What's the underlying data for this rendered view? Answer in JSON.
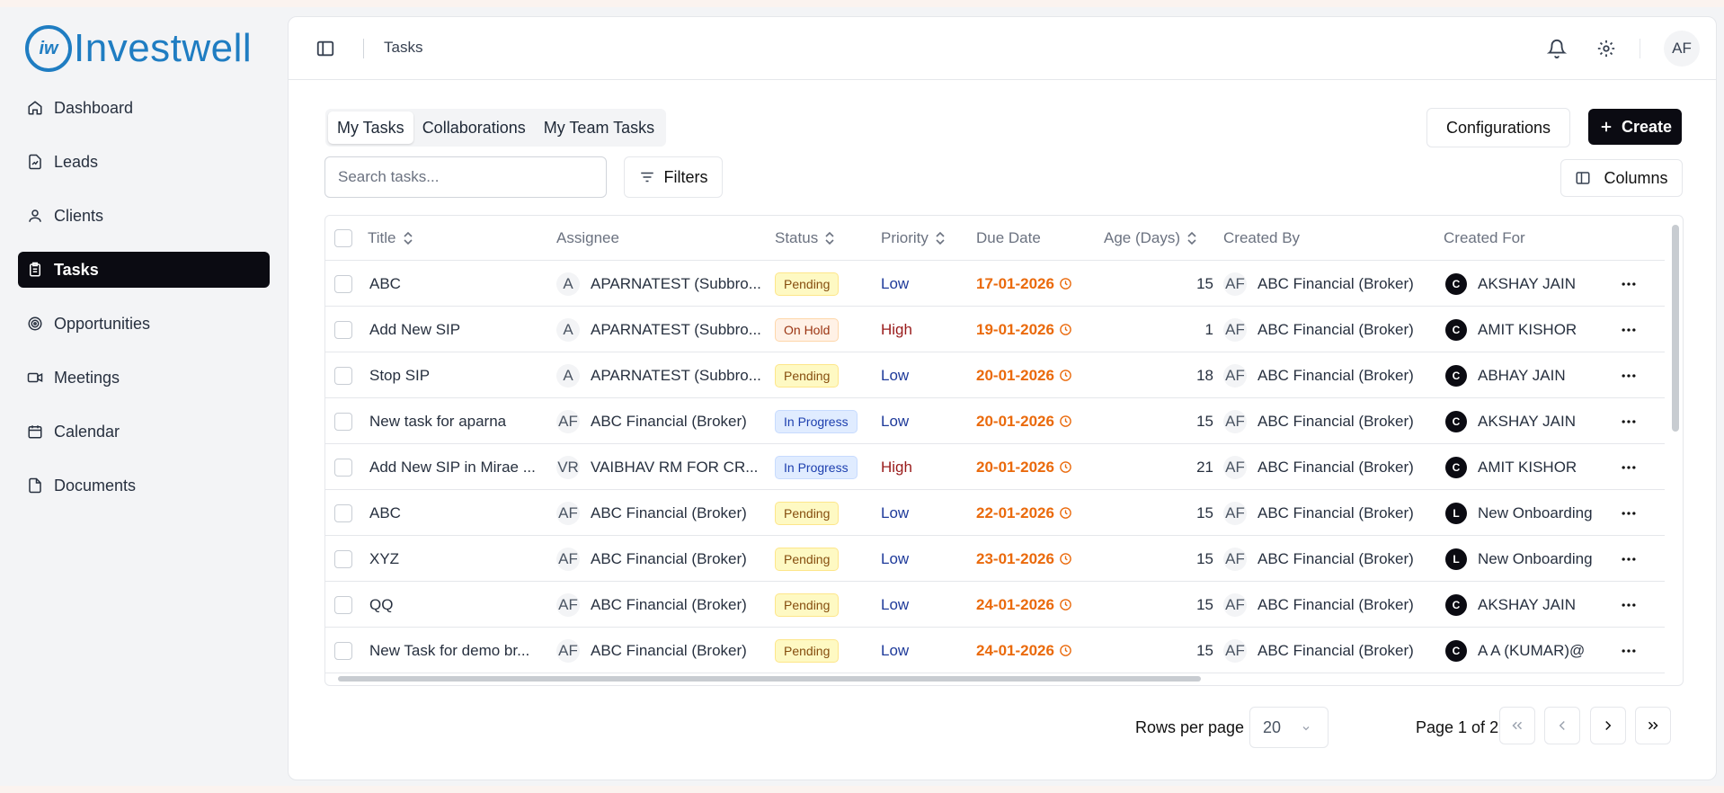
{
  "brand": {
    "logo_mark": "iw",
    "name": "Investwell",
    "color": "#1f7dc2"
  },
  "sidebar": {
    "items": [
      {
        "label": "Dashboard",
        "icon": "home-icon"
      },
      {
        "label": "Leads",
        "icon": "file-chart-icon"
      },
      {
        "label": "Clients",
        "icon": "user-icon"
      },
      {
        "label": "Tasks",
        "icon": "clipboard-list-icon",
        "active": true
      },
      {
        "label": "Opportunities",
        "icon": "target-icon"
      },
      {
        "label": "Meetings",
        "icon": "video-icon"
      },
      {
        "label": "Calendar",
        "icon": "calendar-icon"
      },
      {
        "label": "Documents",
        "icon": "document-icon"
      }
    ]
  },
  "header": {
    "title": "Tasks",
    "avatar": "AF"
  },
  "tabs": [
    {
      "label": "My Tasks",
      "active": true
    },
    {
      "label": "Collaborations"
    },
    {
      "label": "My Team Tasks"
    }
  ],
  "toolbar": {
    "configurations_label": "Configurations",
    "create_label": "Create",
    "search_placeholder": "Search tasks...",
    "filters_label": "Filters",
    "columns_label": "Columns"
  },
  "table": {
    "columns": [
      "Title",
      "Assignee",
      "Status",
      "Priority",
      "Due Date",
      "Age (Days)",
      "Created By",
      "Created For"
    ],
    "rows": [
      {
        "title": "ABC",
        "assignee_initial": "A",
        "assignee": "APARNATEST (Subbro...",
        "status": "Pending",
        "priority": "Low",
        "due": "17-01-2026",
        "age": "15",
        "created_by_initial": "AF",
        "created_by": "ABC Financial (Broker)",
        "for_initial": "C",
        "created_for": "AKSHAY JAIN"
      },
      {
        "title": "Add New SIP",
        "assignee_initial": "A",
        "assignee": "APARNATEST (Subbro...",
        "status": "On Hold",
        "priority": "High",
        "due": "19-01-2026",
        "age": "1",
        "created_by_initial": "AF",
        "created_by": "ABC Financial (Broker)",
        "for_initial": "C",
        "created_for": "AMIT KISHOR"
      },
      {
        "title": "Stop SIP",
        "assignee_initial": "A",
        "assignee": "APARNATEST (Subbro...",
        "status": "Pending",
        "priority": "Low",
        "due": "20-01-2026",
        "age": "18",
        "created_by_initial": "AF",
        "created_by": "ABC Financial (Broker)",
        "for_initial": "C",
        "created_for": "ABHAY JAIN"
      },
      {
        "title": "New task for aparna",
        "assignee_initial": "AF",
        "assignee": "ABC Financial (Broker)",
        "status": "In Progress",
        "priority": "Low",
        "due": "20-01-2026",
        "age": "15",
        "created_by_initial": "AF",
        "created_by": "ABC Financial (Broker)",
        "for_initial": "C",
        "created_for": "AKSHAY JAIN"
      },
      {
        "title": "Add New SIP in Mirae ...",
        "assignee_initial": "VR",
        "assignee": "VAIBHAV RM FOR CR...",
        "status": "In Progress",
        "priority": "High",
        "due": "20-01-2026",
        "age": "21",
        "created_by_initial": "AF",
        "created_by": "ABC Financial (Broker)",
        "for_initial": "C",
        "created_for": "AMIT KISHOR"
      },
      {
        "title": "ABC",
        "assignee_initial": "AF",
        "assignee": "ABC Financial (Broker)",
        "status": "Pending",
        "priority": "Low",
        "due": "22-01-2026",
        "age": "15",
        "created_by_initial": "AF",
        "created_by": "ABC Financial (Broker)",
        "for_initial": "L",
        "created_for": "New Onboarding"
      },
      {
        "title": "XYZ",
        "assignee_initial": "AF",
        "assignee": "ABC Financial (Broker)",
        "status": "Pending",
        "priority": "Low",
        "due": "23-01-2026",
        "age": "15",
        "created_by_initial": "AF",
        "created_by": "ABC Financial (Broker)",
        "for_initial": "L",
        "created_for": "New Onboarding"
      },
      {
        "title": "QQ",
        "assignee_initial": "AF",
        "assignee": "ABC Financial (Broker)",
        "status": "Pending",
        "priority": "Low",
        "due": "24-01-2026",
        "age": "15",
        "created_by_initial": "AF",
        "created_by": "ABC Financial (Broker)",
        "for_initial": "C",
        "created_for": "AKSHAY JAIN"
      },
      {
        "title": "New Task for demo br...",
        "assignee_initial": "AF",
        "assignee": "ABC Financial (Broker)",
        "status": "Pending",
        "priority": "Low",
        "due": "24-01-2026",
        "age": "15",
        "created_by_initial": "AF",
        "created_by": "ABC Financial (Broker)",
        "for_initial": "C",
        "created_for": "A A (KUMAR)@"
      }
    ]
  },
  "pagination": {
    "rows_per_page_label": "Rows per page",
    "rows_per_page_value": "20",
    "page_text": "Page 1 of 2"
  },
  "colors": {
    "accent": "#0b0b12",
    "due_date": "#ea6a0c",
    "priority_low": "#1e3a9a",
    "priority_high": "#991b1b"
  }
}
